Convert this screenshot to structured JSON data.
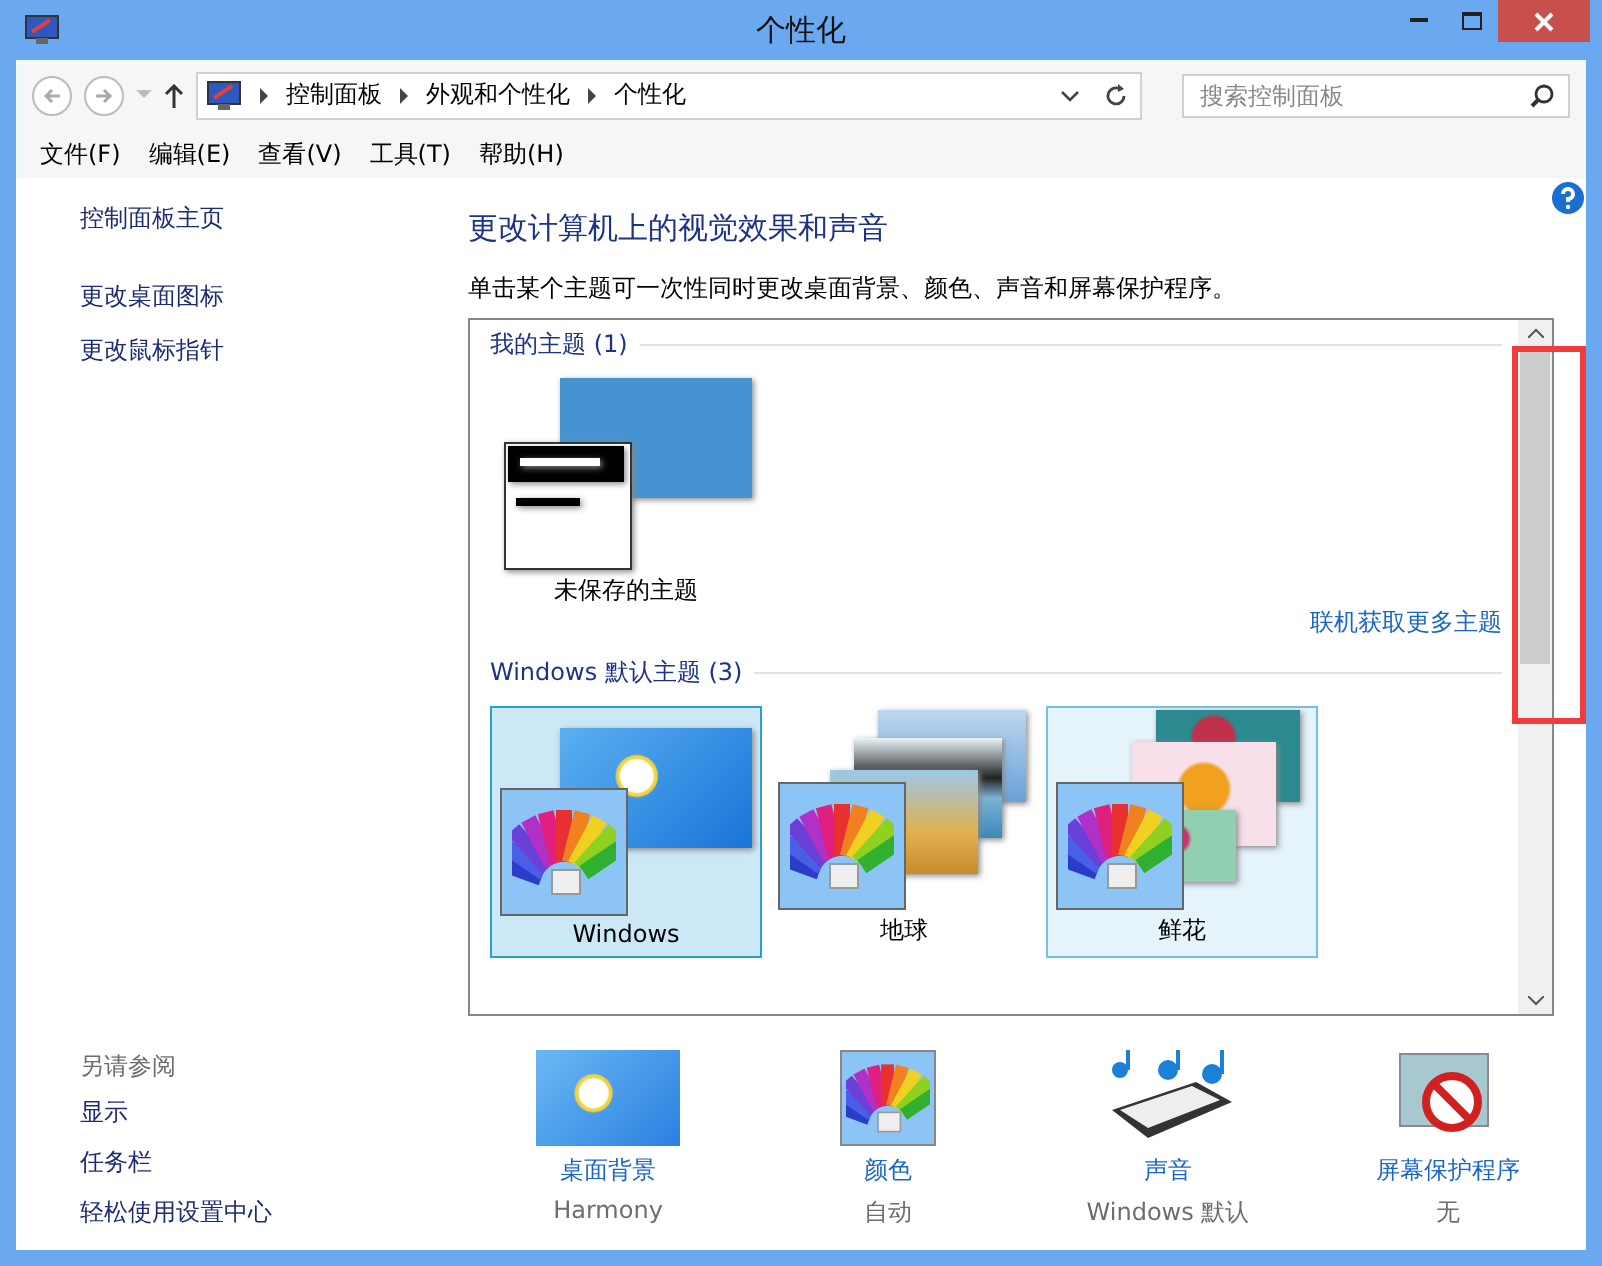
{
  "window": {
    "title": "个性化"
  },
  "address_bar": {
    "crumbs": [
      "控制面板",
      "外观和个性化",
      "个性化"
    ]
  },
  "search": {
    "placeholder": "搜索控制面板"
  },
  "menu": [
    "文件(F)",
    "编辑(E)",
    "查看(V)",
    "工具(T)",
    "帮助(H)"
  ],
  "sidebar": {
    "items": [
      "控制面板主页",
      "更改桌面图标",
      "更改鼠标指针"
    ]
  },
  "heading": "更改计算机上的视觉效果和声音",
  "description": "单击某个主题可一次性同时更改桌面背景、颜色、声音和屏幕保护程序。",
  "theme_groups": [
    {
      "title": "我的主题 (1)",
      "link": "联机获取更多主题",
      "themes": [
        {
          "name": "未保存的主题",
          "kind": "custom",
          "selected": false,
          "hovered": false
        }
      ]
    },
    {
      "title": "Windows 默认主题 (3)",
      "themes": [
        {
          "name": "Windows",
          "kind": "flower",
          "selected": true,
          "hovered": false
        },
        {
          "name": "地球",
          "kind": "earth",
          "selected": false,
          "hovered": false
        },
        {
          "name": "鲜花",
          "kind": "blossom",
          "selected": false,
          "hovered": true
        }
      ]
    }
  ],
  "see_also": {
    "title": "另请参阅",
    "items": [
      "显示",
      "任务栏",
      "轻松使用设置中心"
    ]
  },
  "settings": [
    {
      "kind": "background",
      "label": "桌面背景",
      "value": "Harmony"
    },
    {
      "kind": "color",
      "label": "颜色",
      "value": "自动"
    },
    {
      "kind": "sound",
      "label": "声音",
      "value": "Windows 默认"
    },
    {
      "kind": "screensaver",
      "label": "屏幕保护程序",
      "value": "无"
    }
  ]
}
